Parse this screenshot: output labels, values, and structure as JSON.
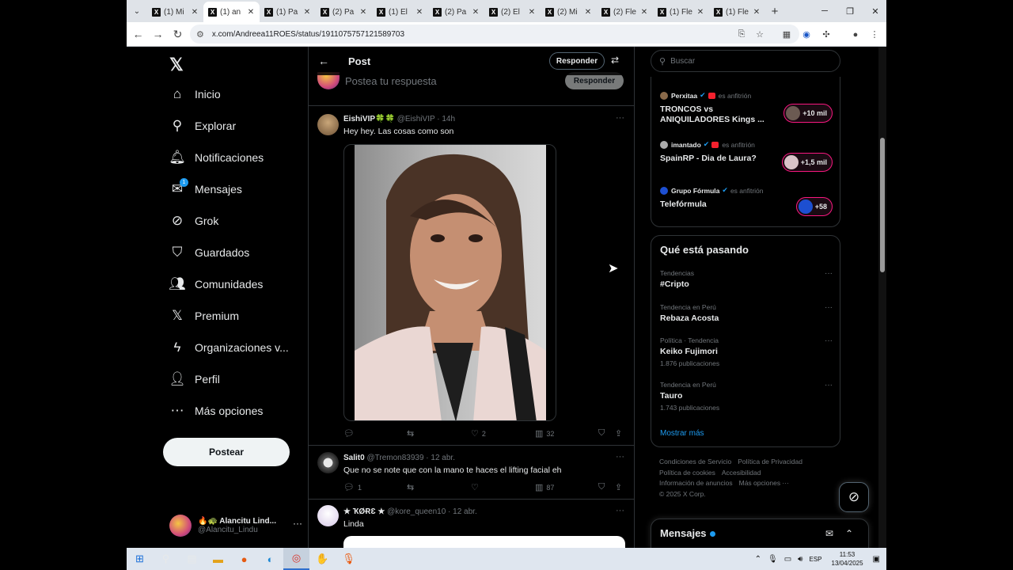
{
  "browser": {
    "tabs": [
      {
        "title": "(1) Mi"
      },
      {
        "title": "(1) an",
        "active": true
      },
      {
        "title": "(1) Pa"
      },
      {
        "title": "(2) Pa"
      },
      {
        "title": "(1) El"
      },
      {
        "title": "(2) Pa"
      },
      {
        "title": "(2) El"
      },
      {
        "title": "(2) Mi"
      },
      {
        "title": "(2) Fle"
      },
      {
        "title": "(1) Fle"
      },
      {
        "title": "(1) Fle"
      }
    ],
    "url": "x.com/Andreea11ROES/status/1911075757121589703"
  },
  "nav": {
    "items": [
      {
        "label": "Inicio",
        "icon": "home-icon"
      },
      {
        "label": "Explorar",
        "icon": "search-icon"
      },
      {
        "label": "Notificaciones",
        "icon": "bell-icon"
      },
      {
        "label": "Mensajes",
        "icon": "mail-icon",
        "badge": "1"
      },
      {
        "label": "Grok",
        "icon": "grok-icon"
      },
      {
        "label": "Guardados",
        "icon": "bookmark-icon"
      },
      {
        "label": "Comunidades",
        "icon": "people-icon"
      },
      {
        "label": "Premium",
        "icon": "x-icon"
      },
      {
        "label": "Organizaciones v...",
        "icon": "lightning-icon"
      },
      {
        "label": "Perfil",
        "icon": "person-icon"
      },
      {
        "label": "Más opciones",
        "icon": "more-circle-icon"
      }
    ],
    "post_button": "Postear",
    "me": {
      "name": "🔥🐢 Alancitu Lind...",
      "handle": "@Alancitu_Lindu"
    }
  },
  "main": {
    "header_title": "Post",
    "reply_top": "Responder",
    "compose_placeholder": "Postea tu respuesta",
    "compose_button": "Responder",
    "tweets": [
      {
        "name": "EishiVIP🍀🍀",
        "meta": "@EishiVIP · 14h",
        "text": "Hey hey. Las cosas como son",
        "replies": "",
        "retweets": "",
        "likes": "2",
        "views": "32"
      },
      {
        "name": "Salit0",
        "meta": "@Tremon83939 · 12 abr.",
        "text": "Que no se note que con la mano te haces el lifting facial eh",
        "replies": "1",
        "retweets": "",
        "likes": "",
        "views": "87"
      },
      {
        "name": "★ ҠØɌƐ ★",
        "meta": "@kore_queen10 · 12 abr.",
        "text": "Linda"
      }
    ]
  },
  "right": {
    "search_placeholder": "Buscar",
    "spaces": [
      {
        "host": "Perxitaa",
        "role": "es anfitrión",
        "title": "TRONCOS vs ANIQUILADORES Kings ...",
        "count": "+10 mil"
      },
      {
        "host": "imantado",
        "role": "es anfitrión",
        "title": "SpainRP - Dia de Laura?",
        "count": "+1,5 mil"
      },
      {
        "host": "Grupo Fórmula",
        "role": "es anfitrión",
        "title": "Telefórmula",
        "count": "+58"
      }
    ],
    "trends_title": "Qué está pasando",
    "trends": [
      {
        "context": "Tendencias",
        "name": "#Cripto",
        "count": ""
      },
      {
        "context": "Tendencia en Perú",
        "name": "Rebaza Acosta",
        "count": ""
      },
      {
        "context": "Política · Tendencia",
        "name": "Keiko Fujimori",
        "count": "1.876 publicaciones"
      },
      {
        "context": "Tendencia en Perú",
        "name": "Tauro",
        "count": "1.743 publicaciones"
      }
    ],
    "show_more": "Mostrar más",
    "footer": {
      "l1": "Condiciones de Servicio",
      "l2": "Política de Privacidad",
      "l3": "Política de cookies",
      "l4": "Accesibilidad",
      "l5": "Información de anuncios",
      "l6": "Más opciones ···",
      "l7": "© 2025 X Corp."
    },
    "messages_title": "Mensajes"
  },
  "taskbar": {
    "lang": "ESP",
    "time": "11:53",
    "date": "13/04/2025"
  },
  "colors": {
    "accent": "#1d9bf0",
    "space_pill": "#f91880",
    "border": "#2f3336"
  }
}
